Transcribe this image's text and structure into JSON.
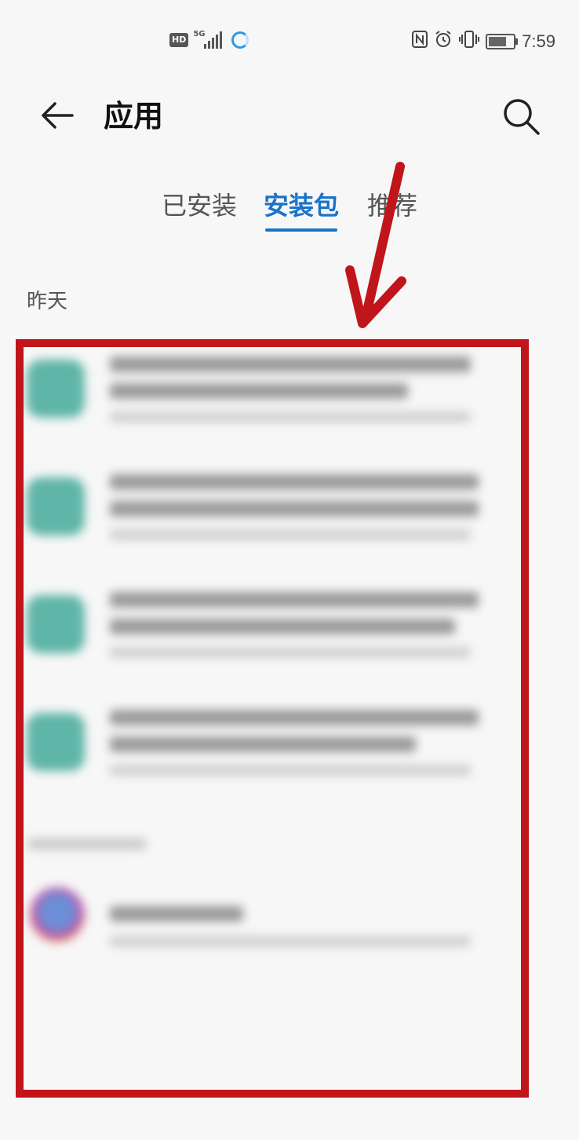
{
  "status_bar": {
    "hd_label": "HD",
    "network_label": "5G",
    "time": "7:59",
    "icons": [
      "nfc-icon",
      "alarm-icon",
      "vibrate-icon",
      "battery-icon"
    ],
    "battery_level": 0.85
  },
  "header": {
    "title": "应用",
    "back_icon": "arrow-left-icon",
    "search_icon": "search-icon"
  },
  "tabs": [
    {
      "label": "已安装",
      "active": false
    },
    {
      "label": "安装包",
      "active": true
    },
    {
      "label": "推荐",
      "active": false
    }
  ],
  "section": {
    "label": "昨天"
  },
  "colors": {
    "accent": "#1a73c9",
    "annotation_red": "#c0151b",
    "apk_icon": "#5fb5a8"
  },
  "annotation": {
    "arrow": "red-arrow",
    "highlight_box": "red-rectangle"
  }
}
